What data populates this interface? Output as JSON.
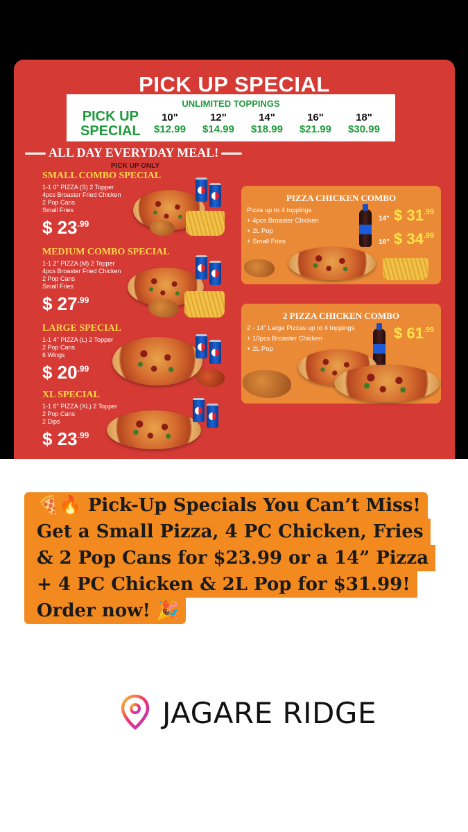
{
  "menu": {
    "title": "PICK UP SPECIAL",
    "unlimited": "UNLIMITED TOPPINGS",
    "pickup_special_label_1": "PICK UP",
    "pickup_special_label_2": "SPECIAL",
    "sizes": [
      {
        "size": "10\"",
        "price": "$12.99"
      },
      {
        "size": "12\"",
        "price": "$14.99"
      },
      {
        "size": "14\"",
        "price": "$18.99"
      },
      {
        "size": "16\"",
        "price": "$21.99"
      },
      {
        "size": "18\"",
        "price": "$30.99"
      }
    ],
    "all_day": "ALL DAY EVERYDAY MEAL!",
    "pickup_only": "PICK UP ONLY",
    "combos": [
      {
        "title": "SMALL COMBO SPECIAL",
        "desc": "1-1 0\" PIZZA (S) 2 Topper\n4pcs Broaster Fried Chicken\n2 Pop Cans\nSmall Fries",
        "price": "$ 23",
        "cents": ".99"
      },
      {
        "title": "MEDIUM COMBO SPECIAL",
        "desc": "1-1 2\" PIZZA (M) 2 Topper\n4pcs Broaster Fried Chicken\n2 Pop Cans\nSmall Fries",
        "price": "$ 27",
        "cents": ".99"
      },
      {
        "title": "LARGE SPECIAL",
        "desc": "1-1 4\" PIZZA (L) 2 Topper\n2 Pop Cans\n6 Wings",
        "price": "$ 20",
        "cents": ".99"
      },
      {
        "title": "XL SPECIAL",
        "desc": "1-1 6\" PIZZA (XL) 2 Topper\n2 Pop Cans\n2 Dips",
        "price": "$ 23",
        "cents": ".99"
      }
    ],
    "pizza_chicken_combo": {
      "title": "PIZZA CHICKEN COMBO",
      "items": [
        "Pizza up to 4 toppings",
        "+ 4pcs Broaster Chicken",
        "+ 2L Pop",
        "+ Small Fries"
      ],
      "price_14_size": "14\"",
      "price_14": "$ 31",
      "price_14_cents": ".99",
      "price_16_size": "16\"",
      "price_16": "$ 34",
      "price_16_cents": ".99"
    },
    "two_pizza_combo": {
      "title": "2 PIZZA CHICKEN COMBO",
      "items": [
        "2 - 14\" Large Pizzas up to 4 toppings",
        "+ 10pcs Broaster Chicken",
        "+ 2L Pop"
      ],
      "price": "$ 61",
      "price_cents": ".99"
    }
  },
  "caption": {
    "line1": "Pick-Up Specials You Can’t Miss!",
    "line2": "Get a Small Pizza, 4 PC Chicken, Fries",
    "line3": "& 2 Pop Cans for $23.99 or a 14” Pizza",
    "line4": "+ 4 PC Chicken & 2L Pop for $31.99!",
    "line5": "Order now!",
    "emoji_start": "🍕🔥",
    "emoji_end": "🎉"
  },
  "location": {
    "label": "JAGARE RIDGE",
    "icon": "location-pin-icon"
  },
  "colors": {
    "menu_red": "#d63a35",
    "card_orange": "#eb8a36",
    "caption_orange": "#f28a1f",
    "price_green": "#1e9a3b",
    "title_yellow": "#ffd84a"
  }
}
